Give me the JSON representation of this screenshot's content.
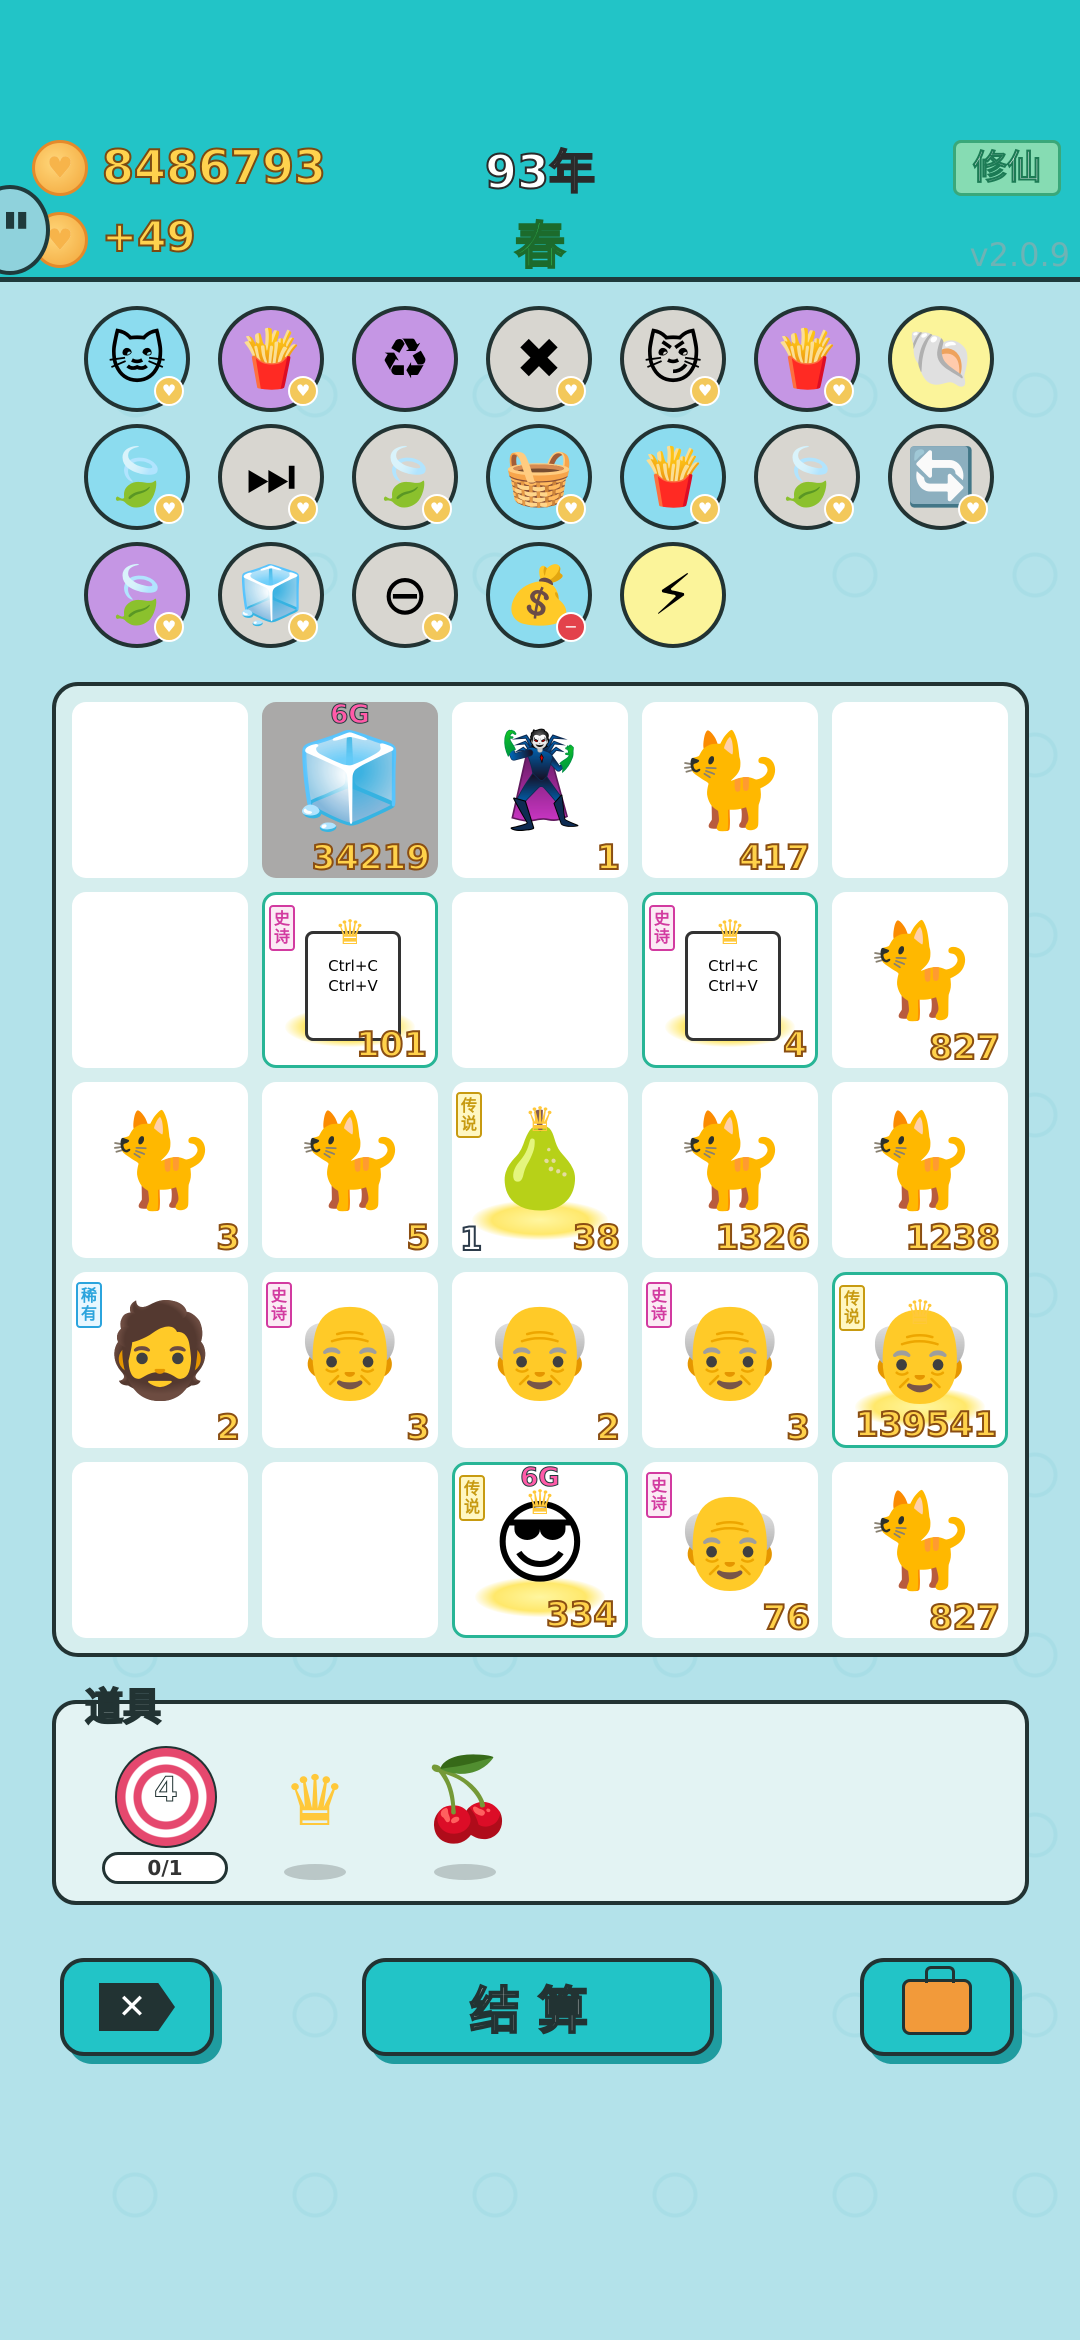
{
  "header": {
    "coins": "8486793",
    "coins_delta": "+49",
    "year": "93年",
    "season": "春",
    "xiuxian_label": "修仙",
    "version": "v2.0.9"
  },
  "skills": [
    {
      "icon": "cat-hole-icon",
      "glyph": "🐱",
      "bg": "blue",
      "badge": "heart"
    },
    {
      "icon": "fries-icon",
      "glyph": "🍟",
      "bg": "purple",
      "badge": "heart"
    },
    {
      "icon": "recycle-icon",
      "glyph": "♻",
      "bg": "purple",
      "badge": ""
    },
    {
      "icon": "delete-tag-icon",
      "glyph": "✖",
      "bg": "grey",
      "badge": "heart"
    },
    {
      "icon": "cat-swap-icon",
      "glyph": "😼",
      "bg": "grey",
      "badge": "heart"
    },
    {
      "icon": "fries-icon",
      "glyph": "🍟",
      "bg": "purple",
      "badge": "heart"
    },
    {
      "icon": "shell-icon",
      "glyph": "🐚",
      "bg": "yellow",
      "badge": ""
    },
    {
      "icon": "leaf-icon",
      "glyph": "🍃",
      "bg": "blue",
      "badge": "heart"
    },
    {
      "icon": "skip-icon",
      "glyph": "⏭",
      "bg": "grey",
      "badge": "heart"
    },
    {
      "icon": "leaf-icon",
      "glyph": "🍃",
      "bg": "grey",
      "badge": "heart"
    },
    {
      "icon": "fruit-basket-icon",
      "glyph": "🧺",
      "bg": "blue",
      "badge": "heart"
    },
    {
      "icon": "fries-icon",
      "glyph": "🍟",
      "bg": "blue",
      "badge": "heart"
    },
    {
      "icon": "leaf-icon",
      "glyph": "🍃",
      "bg": "grey",
      "badge": "heart"
    },
    {
      "icon": "refresh-icon",
      "glyph": "🔄",
      "bg": "grey",
      "badge": "heart"
    },
    {
      "icon": "leaf-icon",
      "glyph": "🍃",
      "bg": "purple",
      "badge": "heart"
    },
    {
      "icon": "sugar-cubes-icon",
      "glyph": "🧊",
      "bg": "grey",
      "badge": "heart"
    },
    {
      "icon": "minus-circle-icon",
      "glyph": "⊖",
      "bg": "grey",
      "badge": "heart"
    },
    {
      "icon": "sack-icon",
      "glyph": "💰",
      "bg": "blue",
      "badge": "minus"
    },
    {
      "icon": "lightning-icon",
      "glyph": "⚡",
      "bg": "yellow",
      "badge": ""
    }
  ],
  "board": [
    {
      "kind": "empty"
    },
    {
      "kind": "fridge",
      "glyph": "🧊",
      "num": "34219",
      "top": "6G",
      "dark": true
    },
    {
      "kind": "thief",
      "glyph": "🦹",
      "num": "1"
    },
    {
      "kind": "cat",
      "glyph": "🐈",
      "num": "417"
    },
    {
      "kind": "empty"
    },
    {
      "kind": "empty"
    },
    {
      "kind": "ctrl",
      "line1": "Ctrl+C",
      "line2": "Ctrl+V",
      "num": "101",
      "tag": "史诗",
      "tagType": "epic",
      "crown": true,
      "epic": true
    },
    {
      "kind": "empty"
    },
    {
      "kind": "ctrl",
      "line1": "Ctrl+C",
      "line2": "Ctrl+V",
      "num": "4",
      "tag": "史诗",
      "tagType": "epic",
      "crown": true,
      "epic": true
    },
    {
      "kind": "cat",
      "glyph": "🐈",
      "num": "827"
    },
    {
      "kind": "cat",
      "glyph": "🐈",
      "num": "3"
    },
    {
      "kind": "cat",
      "glyph": "🐈",
      "num": "5"
    },
    {
      "kind": "pear",
      "glyph": "🍐",
      "num": "38",
      "lnum": "1",
      "tag": "传说",
      "tagType": "legend",
      "crown": true
    },
    {
      "kind": "cat",
      "glyph": "🐈",
      "num": "1326"
    },
    {
      "kind": "cat",
      "glyph": "🐈",
      "num": "1238"
    },
    {
      "kind": "man",
      "glyph": "🧔",
      "num": "2",
      "tag": "稀有",
      "tagType": "rare"
    },
    {
      "kind": "oldman",
      "glyph": "👴",
      "num": "3",
      "tag": "史诗",
      "tagType": "epic"
    },
    {
      "kind": "oldman",
      "glyph": "👴",
      "num": "2"
    },
    {
      "kind": "oldman",
      "glyph": "👴",
      "num": "3",
      "tag": "史诗",
      "tagType": "epic"
    },
    {
      "kind": "oldking",
      "glyph": "👴",
      "num": "139541",
      "tag": "传说",
      "tagType": "legend",
      "crown": true,
      "epic": true
    },
    {
      "kind": "empty"
    },
    {
      "kind": "empty"
    },
    {
      "kind": "cool",
      "glyph": "😎",
      "num": "334",
      "top": "6G",
      "tag": "传说",
      "tagType": "legend",
      "crown": true,
      "epic": true
    },
    {
      "kind": "oldman",
      "glyph": "👴",
      "num": "76",
      "tag": "史诗",
      "tagType": "epic"
    },
    {
      "kind": "cat",
      "glyph": "🐈",
      "num": "827"
    }
  ],
  "items": {
    "label": "道具",
    "target_num": "4",
    "target_count": "0/1",
    "crown_glyph": "♛",
    "fruit_glyph": "🍒"
  },
  "buttons": {
    "close_glyph": "✕",
    "settle_label": "结算"
  },
  "colors": {
    "header_bg": "#22c4c7",
    "page_bg": "#b3e2ea",
    "gold_text": "#ffd24a"
  }
}
